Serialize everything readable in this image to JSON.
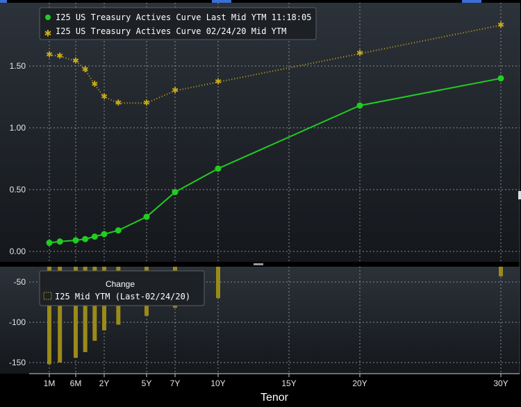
{
  "chart_data": [
    {
      "type": "line",
      "title": "",
      "xlabel": "Tenor",
      "ylabel": "",
      "x": [
        0.0833,
        0.25,
        0.5,
        1,
        2,
        3,
        5,
        7,
        10,
        20,
        30
      ],
      "series": [
        {
          "name": "I25 US Treasury Actives Curve Last Mid YTM 11:18:05",
          "color": "#22cc22",
          "marker": "circle",
          "x": [
            0.0833,
            0.25,
            0.5,
            1,
            1.5,
            2,
            3,
            5,
            7,
            10,
            20,
            30
          ],
          "values": [
            0.07,
            0.08,
            0.09,
            0.1,
            0.12,
            0.14,
            0.17,
            0.28,
            0.48,
            0.67,
            1.18,
            1.4
          ]
        },
        {
          "name": "I25 US Treasury Actives Curve 02/24/20 Mid YTM",
          "color": "#c9ab19",
          "marker": "asterisk",
          "style": "dotted",
          "x": [
            0.0833,
            0.25,
            0.5,
            1,
            1.5,
            2,
            3,
            5,
            7,
            10,
            20,
            30
          ],
          "values": [
            1.59,
            1.58,
            1.54,
            1.47,
            1.35,
            1.25,
            1.2,
            1.2,
            1.3,
            1.37,
            1.6,
            1.83
          ]
        }
      ],
      "ylim": [
        -0.05,
        1.95
      ],
      "yticks": [
        0.0,
        0.5,
        1.0,
        1.5
      ],
      "ytick_labels": [
        "0.00",
        "0.50",
        "1.00",
        "1.50"
      ],
      "xticks": [
        0.0833,
        0.5,
        2,
        5,
        7,
        10,
        15,
        20,
        30
      ],
      "xtick_labels": [
        "1M",
        "6M",
        "2Y",
        "5Y",
        "7Y",
        "10Y",
        "15Y",
        "20Y",
        "30Y"
      ],
      "grid": true,
      "legend_position": "top-left"
    },
    {
      "type": "bar",
      "title": "Change",
      "series": [
        {
          "name": "I25 Mid YTM (Last-02/24/20)",
          "color": "#9a8a1a",
          "x": [
            0.0833,
            0.25,
            0.5,
            1,
            1.5,
            2,
            3,
            5,
            7,
            10,
            30
          ],
          "values": [
            -152,
            -150,
            -144,
            -137,
            -123,
            -110,
            -103,
            -92,
            -82,
            -70,
            -43
          ]
        }
      ],
      "ylim": [
        -160,
        -30
      ],
      "yticks": [
        -50,
        -100,
        -150
      ],
      "ytick_labels": [
        "-50",
        "-100",
        "-150"
      ],
      "grid": true,
      "legend_position": "top-left"
    }
  ],
  "colors": {
    "background_top": "#2c323a",
    "background_bottom": "#14171b",
    "grid": "#8c8c8c",
    "axis_text": "#e6e6e6"
  }
}
